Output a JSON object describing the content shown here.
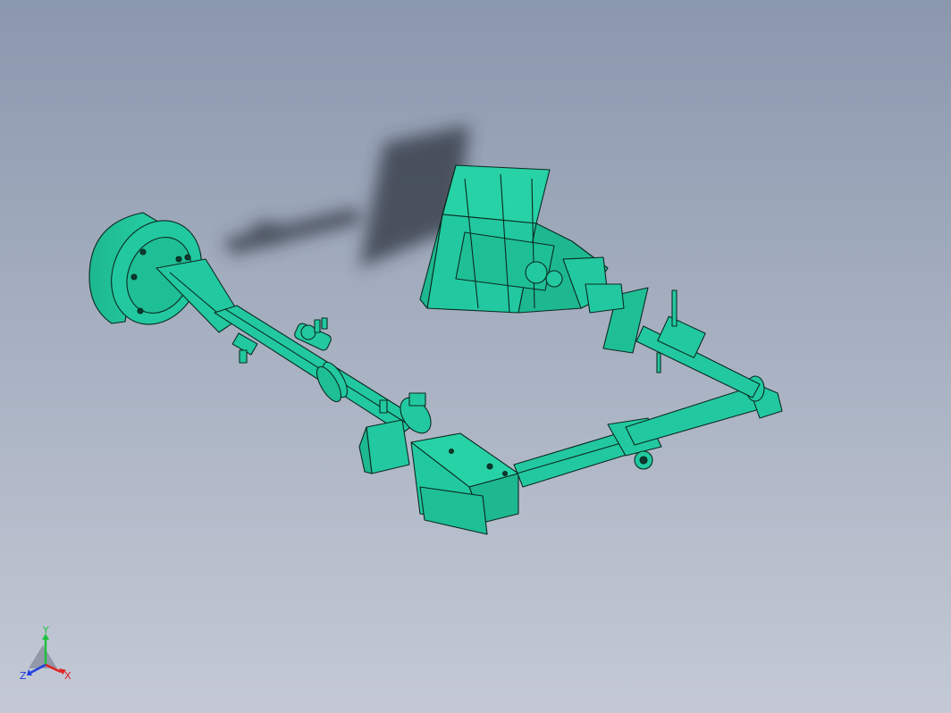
{
  "viewport": {
    "background_top": "#8a97ad",
    "background_bottom": "#c4c9d5",
    "model_color": "#22c9a0",
    "edge_color": "#0a2a20",
    "shadow_color": "#2e3440"
  },
  "triad": {
    "x_label": "X",
    "y_label": "Y",
    "z_label": "Z",
    "x_color": "#e02020",
    "y_color": "#20c040",
    "z_color": "#2040e0"
  }
}
